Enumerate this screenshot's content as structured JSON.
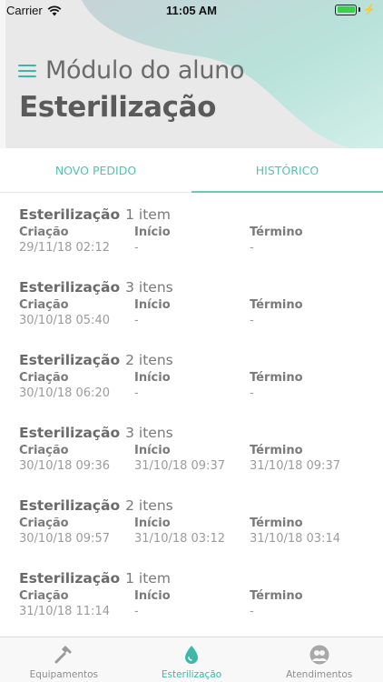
{
  "status_bar": {
    "carrier": "Carrier",
    "time": "11:05 AM",
    "battery_level": 1.0
  },
  "header": {
    "module_title": "Módulo do aluno",
    "page_title": "Esterilização"
  },
  "tabs": [
    {
      "label": "NOVO PEDIDO",
      "active": false
    },
    {
      "label": "HISTÓRICO",
      "active": true
    }
  ],
  "column_labels": {
    "created": "Criação",
    "start": "Início",
    "end": "Término"
  },
  "orders": [
    {
      "name": "Esterilização",
      "count": "1 item",
      "created": "29/11/18 02:12",
      "start": "-",
      "end": "-"
    },
    {
      "name": "Esterilização",
      "count": "3 itens",
      "created": "30/10/18 05:40",
      "start": "-",
      "end": "-"
    },
    {
      "name": "Esterilização",
      "count": "2 itens",
      "created": "30/10/18 06:20",
      "start": "-",
      "end": "-"
    },
    {
      "name": "Esterilização",
      "count": "3 itens",
      "created": "30/10/18 09:36",
      "start": "31/10/18 09:37",
      "end": "31/10/18 09:37"
    },
    {
      "name": "Esterilização",
      "count": "2 itens",
      "created": "30/10/18 09:57",
      "start": "31/10/18 03:12",
      "end": "31/10/18 03:14"
    },
    {
      "name": "Esterilização",
      "count": "1 item",
      "created": "31/10/18 11:14",
      "start": "-",
      "end": "-"
    }
  ],
  "tabbar": [
    {
      "label": "Equipamentos",
      "icon": "hammer-icon",
      "active": false
    },
    {
      "label": "Esterilização",
      "icon": "drop-icon",
      "active": true
    },
    {
      "label": "Atendimentos",
      "icon": "people-icon",
      "active": false
    }
  ],
  "colors": {
    "accent": "#3cb7a8",
    "header_bg": "#e9e9e9",
    "blob": "#bfe6df"
  }
}
